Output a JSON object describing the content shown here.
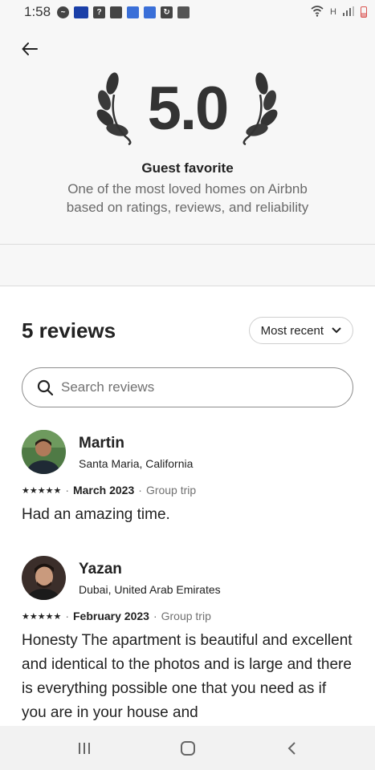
{
  "status_bar": {
    "time": "1:58",
    "signal_label": "H"
  },
  "hero": {
    "rating": "5.0",
    "title": "Guest favorite",
    "description": "One of the most loved homes on Airbnb based on ratings, reviews, and reliability"
  },
  "reviews": {
    "count_label": "5 reviews",
    "sort_label": "Most recent",
    "search_placeholder": "Search reviews",
    "items": [
      {
        "name": "Martin",
        "location": "Santa Maria, California",
        "stars": "★★★★★",
        "date": "March 2023",
        "trip": "Group trip",
        "text": "Had an amazing time."
      },
      {
        "name": "Yazan",
        "location": "Dubai, United Arab Emirates",
        "stars": "★★★★★",
        "date": "February 2023",
        "trip": "Group trip",
        "text": "Honesty The apartment is beautiful and excellent and identical to the photos and is large and there is everything possible one that you need as if you are in your house and"
      }
    ]
  },
  "colors": {
    "hero_bg": "#f7f7f7",
    "text_primary": "#222222",
    "text_secondary": "#717171"
  }
}
